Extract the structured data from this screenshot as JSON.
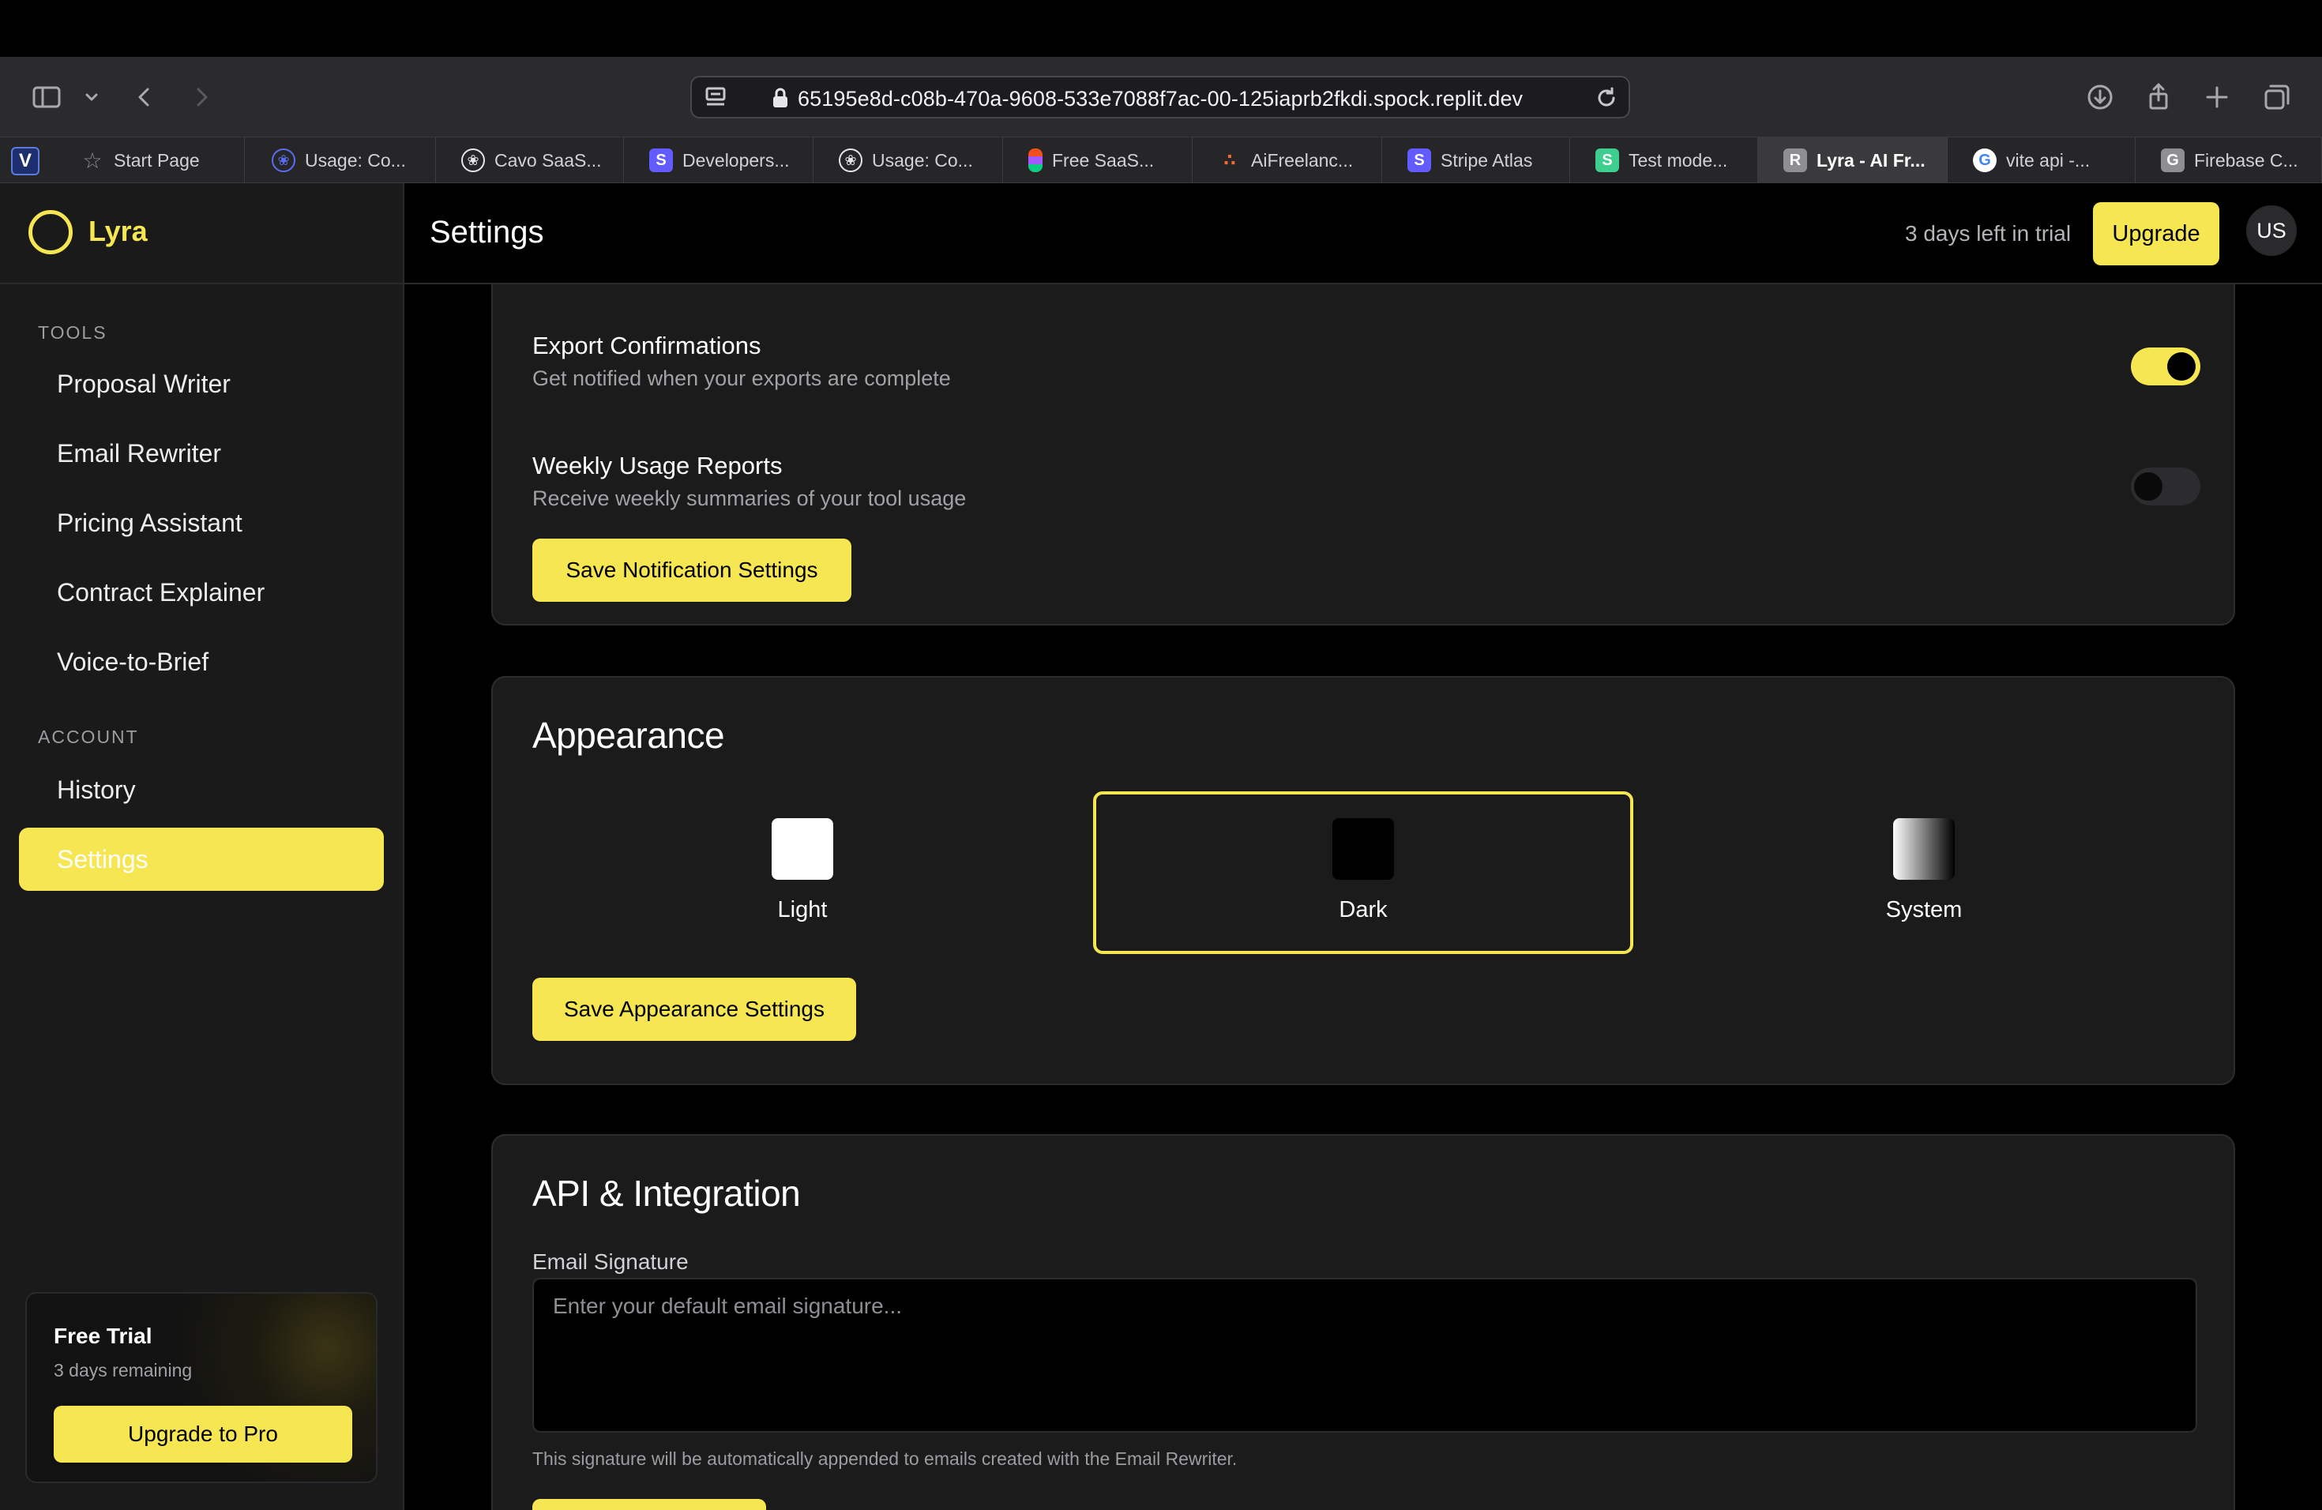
{
  "browser": {
    "url": "65195e8d-c08b-470a-9608-533e7088f7ac-00-125iaprb2fkdi.spock.replit.dev",
    "pinned_tab": "V",
    "tabs": [
      {
        "label": "Start Page",
        "icon": "star-icon",
        "color": "#8e8e93"
      },
      {
        "label": "Usage: Co...",
        "icon": "openai-icon",
        "color": "#5b6cf2"
      },
      {
        "label": "Cavo SaaS...",
        "icon": "openai-icon",
        "color": "#e5e5ea"
      },
      {
        "label": "Developers...",
        "icon": "S",
        "color": "#635bff"
      },
      {
        "label": "Usage: Co...",
        "icon": "openai-icon",
        "color": "#e5e5ea"
      },
      {
        "label": "Free SaaS...",
        "icon": "figma-icon",
        "color": "#f24e1e"
      },
      {
        "label": "AiFreelanc...",
        "icon": "dots-icon",
        "color": "#f26a2e"
      },
      {
        "label": "Stripe Atlas",
        "icon": "S",
        "color": "#635bff"
      },
      {
        "label": "Test mode...",
        "icon": "S",
        "color": "#3ecf8e"
      },
      {
        "label": "Lyra - AI Fr...",
        "icon": "R",
        "color": "#8e8e93",
        "active": true
      },
      {
        "label": "vite api  -...",
        "icon": "G",
        "color": "#ffffff"
      },
      {
        "label": "Firebase C...",
        "icon": "G",
        "color": "#8e8e93"
      }
    ]
  },
  "brand": {
    "name": "Lyra"
  },
  "sidebar": {
    "tools_label": "TOOLS",
    "tools": [
      "Proposal Writer",
      "Email Rewriter",
      "Pricing Assistant",
      "Contract Explainer",
      "Voice-to-Brief"
    ],
    "account_label": "ACCOUNT",
    "account": [
      "History",
      "Settings"
    ],
    "active": "Settings",
    "trial_card": {
      "title": "Free Trial",
      "subtitle": "3 days remaining",
      "button": "Upgrade to Pro"
    }
  },
  "topbar": {
    "title": "Settings",
    "trial_text": "3 days left in trial",
    "upgrade_label": "Upgrade",
    "avatar": "US"
  },
  "notifications": {
    "items": [
      {
        "title": "Export Confirmations",
        "desc": "Get notified when your exports are complete",
        "enabled": true
      },
      {
        "title": "Weekly Usage Reports",
        "desc": "Receive weekly summaries of your tool usage",
        "enabled": false
      }
    ],
    "save_label": "Save Notification Settings"
  },
  "appearance": {
    "heading": "Appearance",
    "options": [
      "Light",
      "Dark",
      "System"
    ],
    "selected": "Dark",
    "save_label": "Save Appearance Settings"
  },
  "api": {
    "heading": "API & Integration",
    "field_label": "Email Signature",
    "placeholder": "Enter your default email signature...",
    "hint": "This signature will be automatically appended to emails created with the Email Rewriter."
  },
  "colors": {
    "accent": "#f6e651",
    "background": "#000000",
    "surface": "#1b1b1c"
  }
}
